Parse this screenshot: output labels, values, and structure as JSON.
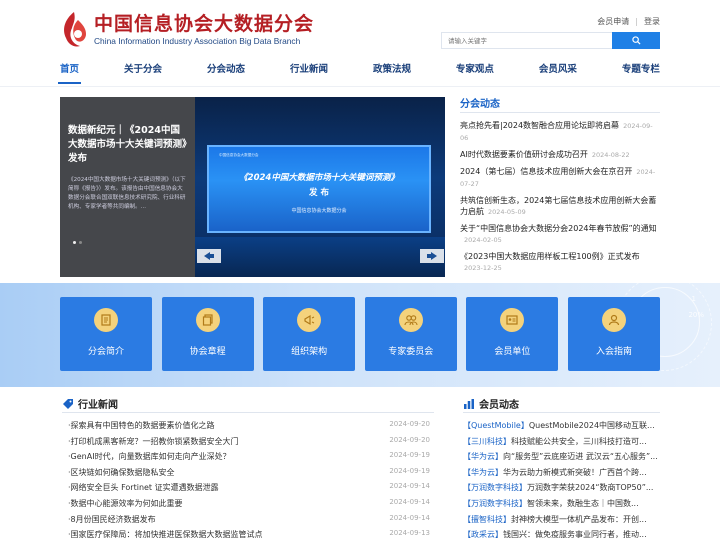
{
  "brand": {
    "name_cn": "中国信息协会大数据分会",
    "name_en": "China Information Industry Association Big Data Branch"
  },
  "top_links": {
    "apply": "会员申请",
    "login": "登录"
  },
  "search": {
    "placeholder": "请输入关键字",
    "icon": "search-icon"
  },
  "nav": {
    "items": [
      "首页",
      "关于分会",
      "分会动态",
      "行业新闻",
      "政策法规",
      "专家观点",
      "会员风采",
      "专题专栏"
    ],
    "active": 0
  },
  "banner": {
    "title": "数据新纪元｜《2024中国大数据市场十大关键词预测》发布",
    "desc": "《2024中国大数据市场十大关键词预测》（以下简称《报告》）发布。该报告由中国信息协会大数据分会联合国双联信息技术研究院、行业科研机构、专家学者等共同编制。...",
    "screen_header": "中国信息协会大数据分会",
    "screen_title": "《2024中国大数据市场十大关键词预测》",
    "screen_sub": "发 布",
    "screen_org": "中国信息协会大数据分会",
    "prev_icon": "prev-icon",
    "next_icon": "next-icon"
  },
  "branch_news": {
    "heading": "分会动态",
    "items": [
      {
        "title": "亮点抢先看|2024数智融合应用论坛即将启幕",
        "date": "2024-09-06"
      },
      {
        "title": "AI时代数据要素价值研讨会成功召开",
        "date": "2024-08-22"
      },
      {
        "title": "2024（第七届）信息技术应用创新大会在京召开",
        "date": "2024-07-27"
      },
      {
        "title": "共筑信创新生态，2024第七届信息技术应用创新大会蓄力启航",
        "date": "2024-05-09"
      },
      {
        "title": "关于“中国信息协会大数据分会2024年春节放假”的通知",
        "date": "2024-02-05"
      },
      {
        "title": "《2023中国大数据应用样板工程100例》正式发布",
        "date": "2023-12-25"
      }
    ]
  },
  "band": {
    "pct_a": "20%",
    "pct_b": "1"
  },
  "cards": [
    {
      "label": "分会简介",
      "icon": "document-icon"
    },
    {
      "label": "协会章程",
      "icon": "copy-icon"
    },
    {
      "label": "组织架构",
      "icon": "megaphone-icon"
    },
    {
      "label": "专家委员会",
      "icon": "group-icon"
    },
    {
      "label": "会员单位",
      "icon": "id-card-icon"
    },
    {
      "label": "入会指南",
      "icon": "user-icon"
    }
  ],
  "industry_news": {
    "heading": "行业新闻",
    "icon": "tag-icon",
    "items": [
      {
        "title": "·探索具有中国特色的数据要素价值化之路",
        "date": "2024-09-20"
      },
      {
        "title": "·打印机成黑客新宠？一招教你锁紧数据安全大门",
        "date": "2024-09-20"
      },
      {
        "title": "·GenAI时代，向量数据库如何走向产业深处？",
        "date": "2024-09-19"
      },
      {
        "title": "·区块链如何确保数据隐私安全",
        "date": "2024-09-19"
      },
      {
        "title": "·网络安全巨头 Fortinet 证实遭遇数据泄露",
        "date": "2024-09-14"
      },
      {
        "title": "·数据中心能源效率为何如此重要",
        "date": "2024-09-14"
      },
      {
        "title": "·8月份国民经济数据发布",
        "date": "2024-09-14"
      },
      {
        "title": "·国家医疗保障局：将加快推进医保数据大数据监管试点",
        "date": "2024-09-13"
      }
    ]
  },
  "member_news": {
    "heading": "会员动态",
    "icon": "bar-chart-icon",
    "items": [
      {
        "tag": "【QuestMobile】",
        "text": "QuestMobile2024中国移动互联..."
      },
      {
        "tag": "【三川科技】",
        "text": "科技赋能公共安全，三川科技打造可..."
      },
      {
        "tag": "【华为云】",
        "text": "向“服务型”云底座迈进 武汉云“五心服务”..."
      },
      {
        "tag": "【华为云】",
        "text": "华为云助力新模式新突破！广西首个跨..."
      },
      {
        "tag": "【万润数字科技】",
        "text": "万润数字荣获2024“数商TOP50”..."
      },
      {
        "tag": "【万润数字科技】",
        "text": "智领未来，数融生态｜中国数..."
      },
      {
        "tag": "【擅智科技】",
        "text": "封神榜大模型一体机产品发布：开创..."
      },
      {
        "tag": "【政采云】",
        "text": "钱国兴：做免疫服务事业同行者，推动..."
      }
    ]
  },
  "colors": {
    "brand_red": "#b51f24",
    "accent_blue": "#1a63c6",
    "card_blue": "#2b7be3",
    "icon_gold": "#f4d27c"
  }
}
